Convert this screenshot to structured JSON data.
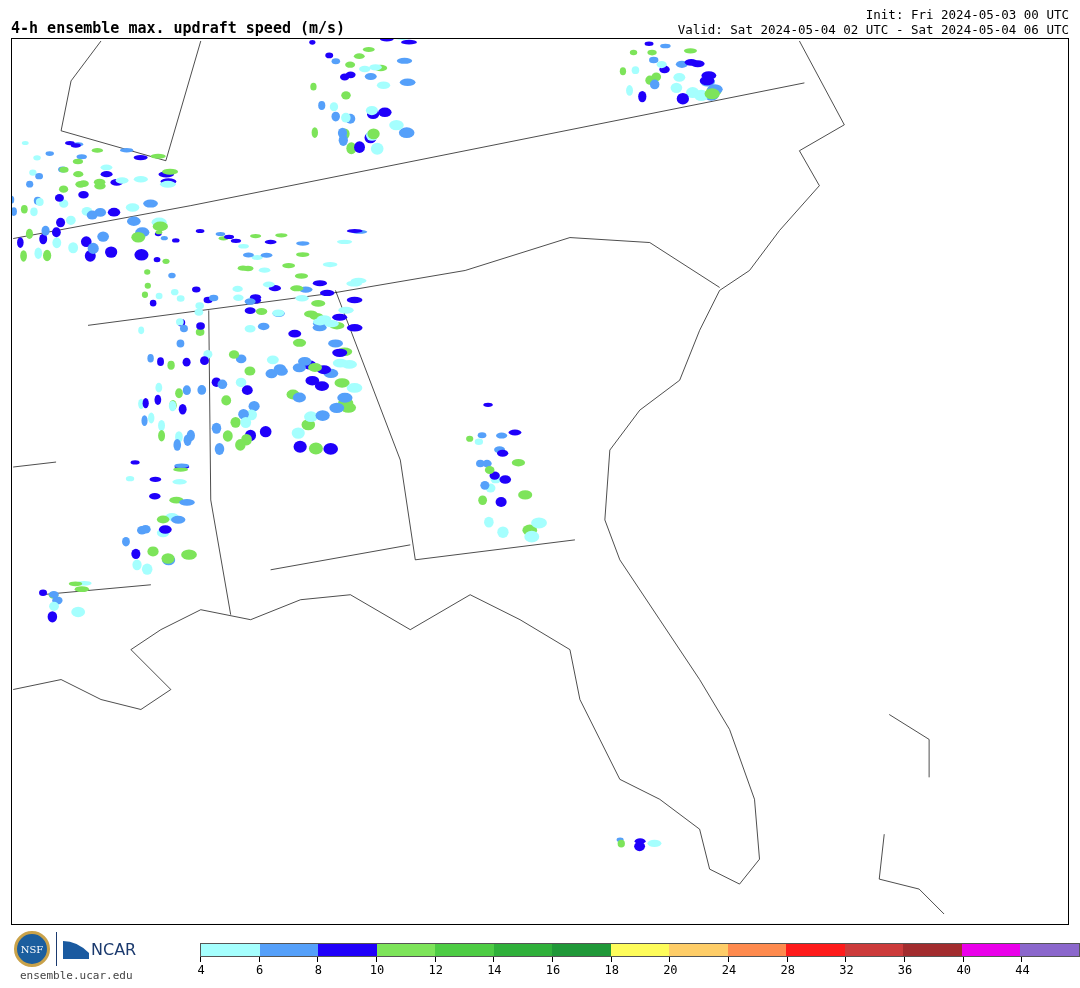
{
  "title": "4-h ensemble max. updraft speed (m/s)",
  "init": "Init: Fri 2024-05-03 00 UTC",
  "valid": "Valid: Sat 2024-05-04 02 UTC - Sat 2024-05-04 06 UTC",
  "logos": {
    "nsf": "NSF",
    "ncar": "NCAR",
    "url": "ensemble.ucar.edu"
  },
  "colorbar": [
    {
      "color": "#a5fffe",
      "label": "4"
    },
    {
      "color": "#55a0fa",
      "label": "6"
    },
    {
      "color": "#1f00fa",
      "label": "8"
    },
    {
      "color": "#7de45a",
      "label": "10"
    },
    {
      "color": "#4dcc44",
      "label": "12"
    },
    {
      "color": "#2fb03a",
      "label": "14"
    },
    {
      "color": "#209838",
      "label": "16"
    },
    {
      "color": "#fefc5a",
      "label": "18"
    },
    {
      "color": "#fecd68",
      "label": "20"
    },
    {
      "color": "#fe8a4e",
      "label": "24"
    },
    {
      "color": "#fe1b1b",
      "label": "28"
    },
    {
      "color": "#cc3b3b",
      "label": "32"
    },
    {
      "color": "#a22c2e",
      "label": "36"
    },
    {
      "color": "#ea00ea",
      "label": "40"
    },
    {
      "color": "#8b67cc",
      "label": "44"
    }
  ]
}
